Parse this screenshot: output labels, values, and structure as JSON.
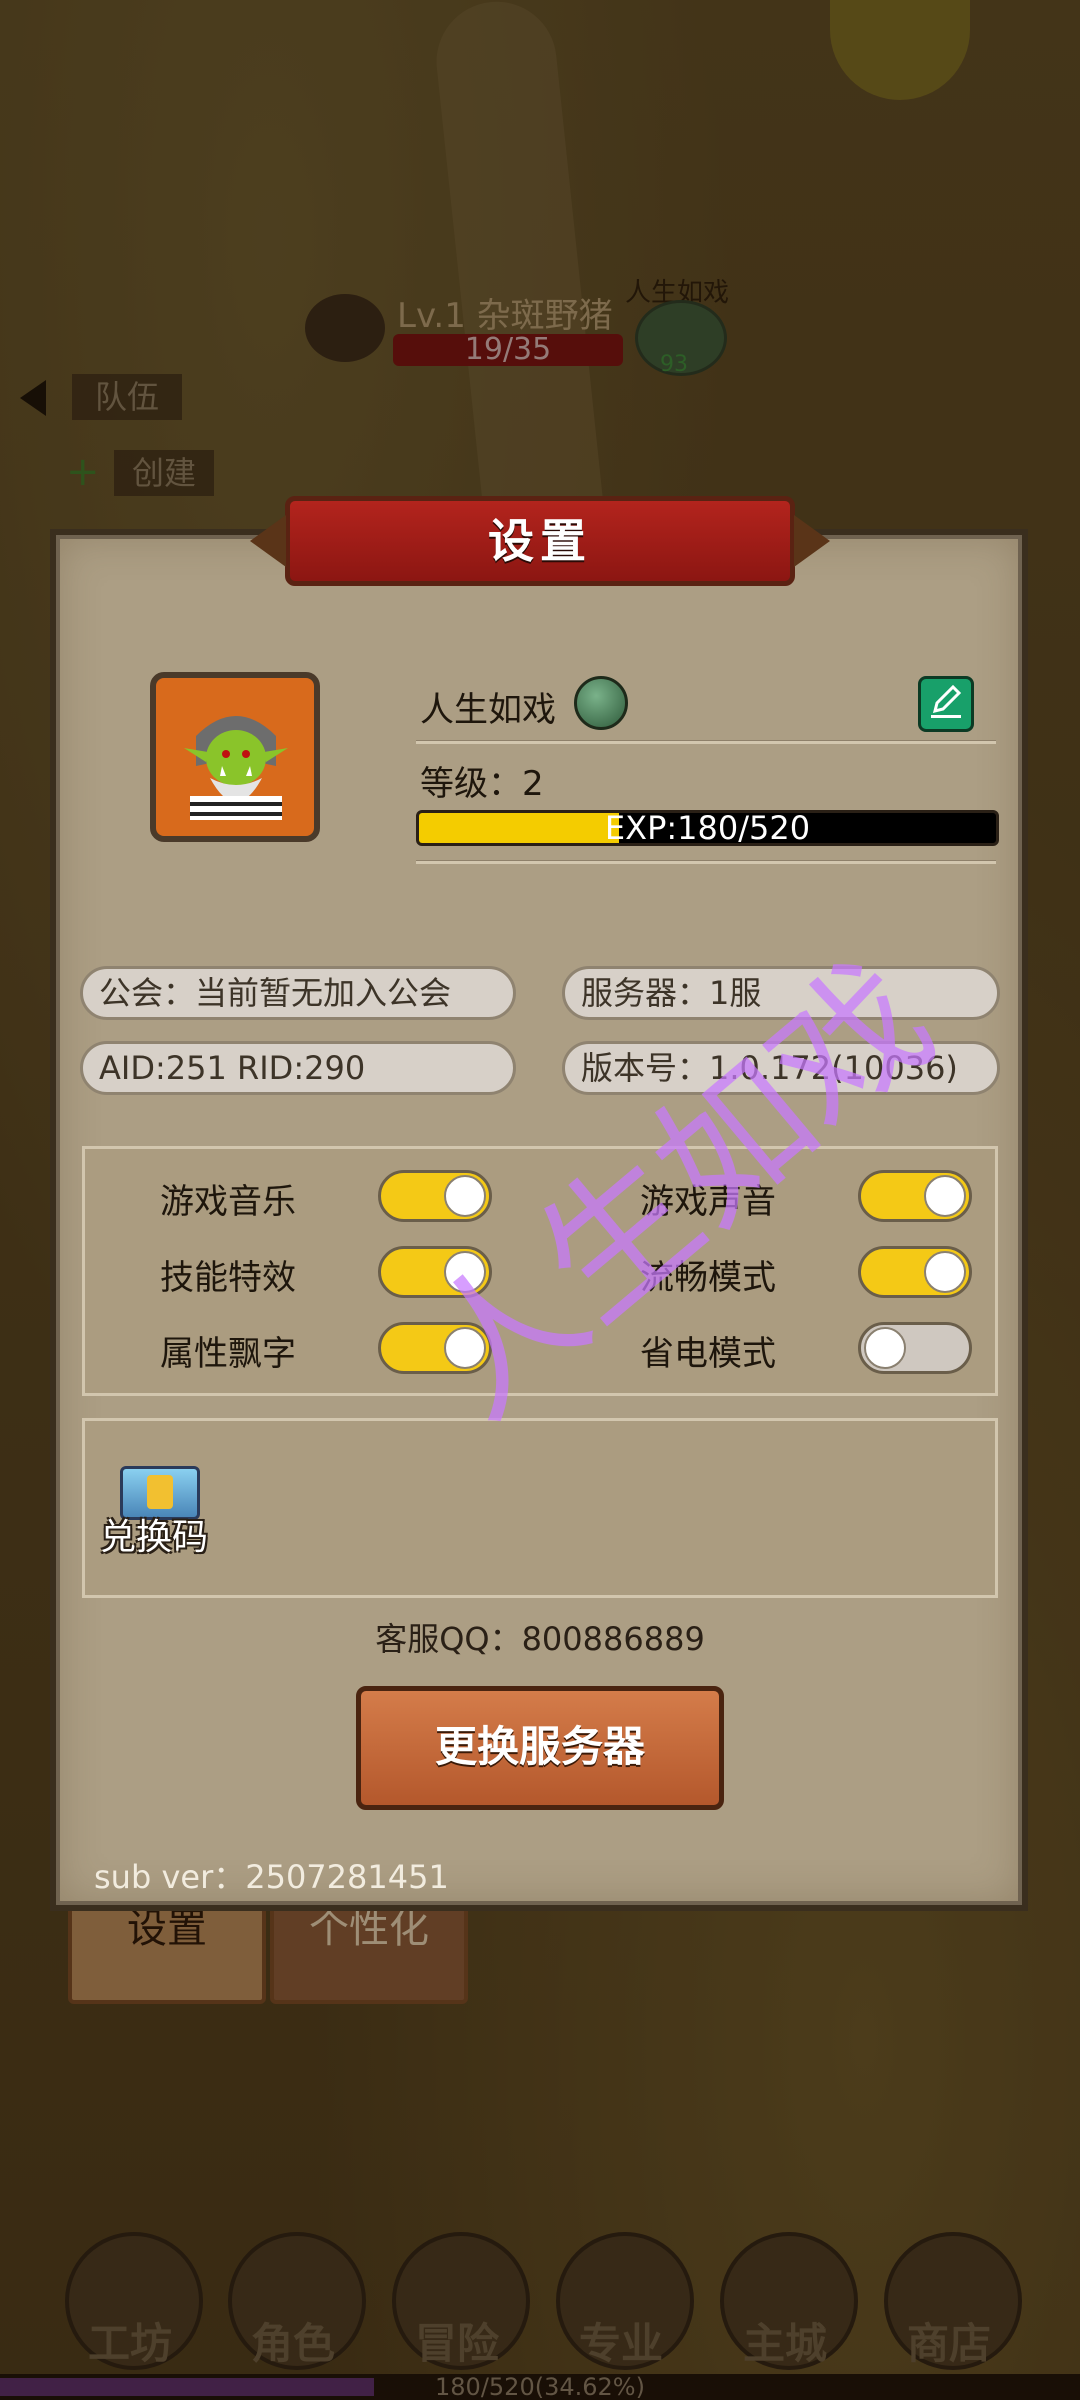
{
  "background": {
    "enemy": {
      "name": "Lv.1 杂斑野猪",
      "hp": "19/35"
    },
    "player_marker": {
      "name": "人生如戏",
      "number": "93"
    },
    "team_tab_label": "队伍",
    "create_tab_label": "创建",
    "bottom_tabs": [
      {
        "label": "设置",
        "selected": true
      },
      {
        "label": "个性化",
        "selected": false
      }
    ],
    "nav": [
      {
        "label": "工坊",
        "icon": "workshop-icon"
      },
      {
        "label": "角色",
        "icon": "character-icon"
      },
      {
        "label": "冒险",
        "icon": "adventure-icon"
      },
      {
        "label": "专业",
        "icon": "profession-icon"
      },
      {
        "label": "主城",
        "icon": "main-city-icon"
      },
      {
        "label": "商店",
        "icon": "shop-icon"
      }
    ],
    "xp_bottom": {
      "text": "180/520(34.62%)",
      "fraction": 0.3462
    }
  },
  "dialog": {
    "title": "设置",
    "player": {
      "name": "人生如戏",
      "level_text": "等级：2",
      "exp_text": "EXP:180/520",
      "exp_fraction": 0.346
    },
    "info": {
      "guild": "公会：当前暂无加入公会",
      "server": "服务器：1服",
      "ids": "AID:251   RID:290",
      "version": "版本号：1.0.172(10036)"
    },
    "toggles": [
      {
        "label": "游戏音乐",
        "on": true
      },
      {
        "label": "游戏声音",
        "on": true
      },
      {
        "label": "技能特效",
        "on": true
      },
      {
        "label": "流畅模式",
        "on": true
      },
      {
        "label": "属性飘字",
        "on": true
      },
      {
        "label": "省电模式",
        "on": false
      }
    ],
    "redeem_label": "兑换码",
    "watermark": "人生如戏",
    "support_qq": "客服QQ：800886889",
    "change_server_label": "更换服务器",
    "sub_ver": "sub ver：2507281451"
  },
  "colors": {
    "exp_fill": "#f4cc00",
    "toggle_on": "#f4c916",
    "toggle_off": "#cfc8c0",
    "banner_red": "#b3241d",
    "button_orange": "#d47c4a",
    "edit_green": "#18a06a"
  }
}
